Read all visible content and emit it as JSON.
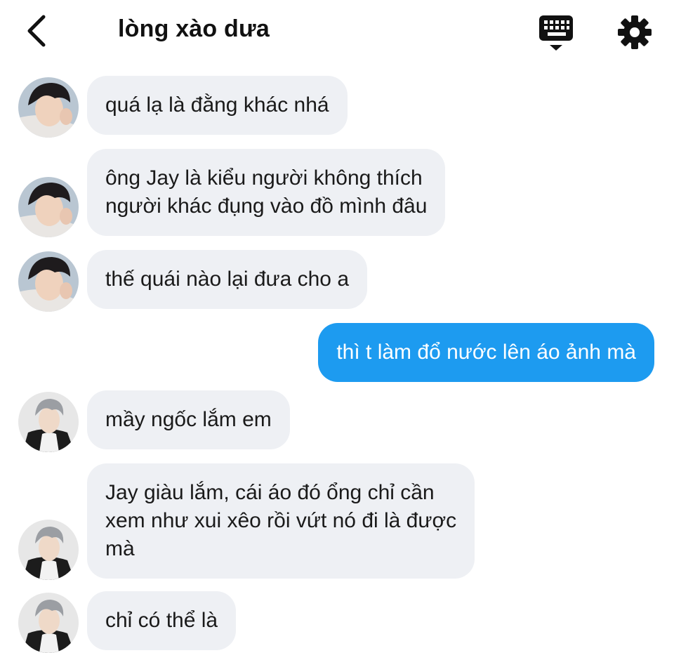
{
  "header": {
    "title": "lòng xào dưa",
    "back_icon": "chevron-left-icon",
    "keyboard_icon": "keyboard-icon",
    "settings_icon": "gear-icon"
  },
  "colors": {
    "outgoing_bubble": "#1d9bf0",
    "incoming_bubble": "#eef0f4"
  },
  "messages": [
    {
      "direction": "incoming",
      "sender": "dark-hair",
      "text": "quá lạ là đằng khác nhá"
    },
    {
      "direction": "incoming",
      "sender": "dark-hair",
      "text": "ông Jay là kiểu người không thích\nngười khác đụng vào đồ mình đâu"
    },
    {
      "direction": "incoming",
      "sender": "dark-hair",
      "text": "thế quái nào lại đưa cho a"
    },
    {
      "direction": "outgoing",
      "text": "thì t làm đổ nước lên áo ảnh mà"
    },
    {
      "direction": "incoming",
      "sender": "silver-hair",
      "text": "mầy ngốc lắm em"
    },
    {
      "direction": "incoming",
      "sender": "silver-hair",
      "text": "Jay giàu lắm, cái áo đó ổng chỉ cần\nxem như xui xêo rồi vứt nó đi là được\nmà"
    },
    {
      "direction": "incoming",
      "sender": "silver-hair",
      "text": "chỉ có thể là"
    }
  ]
}
